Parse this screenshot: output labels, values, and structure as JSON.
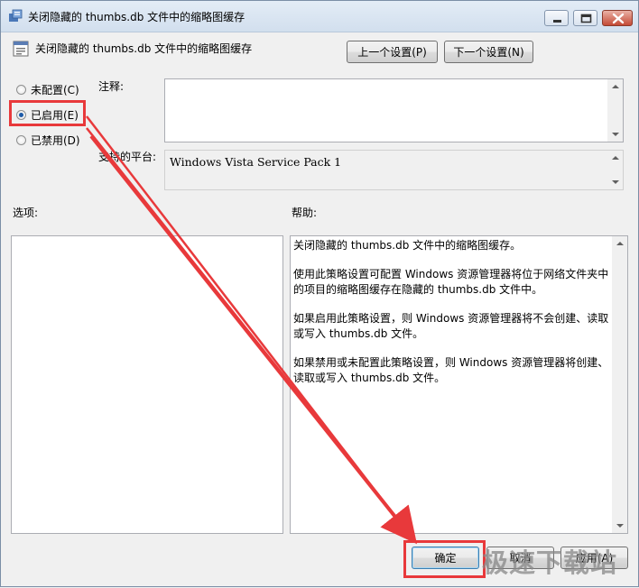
{
  "window": {
    "title": "关闭隐藏的 thumbs.db 文件中的缩略图缓存",
    "controls": [
      "minimize",
      "maximize",
      "close"
    ]
  },
  "policy": {
    "name": "关闭隐藏的 thumbs.db 文件中的缩略图缓存",
    "icon": "policy-setting-icon"
  },
  "nav": {
    "prev_label": "上一个设置(P)",
    "next_label": "下一个设置(N)"
  },
  "state": {
    "options": [
      {
        "label": "未配置(C)",
        "selected": false
      },
      {
        "label": "已启用(E)",
        "selected": true
      },
      {
        "label": "已禁用(D)",
        "selected": false
      }
    ]
  },
  "comment": {
    "label": "注释:",
    "value": ""
  },
  "platform": {
    "label": "支持的平台:",
    "value": "Windows Vista Service Pack 1"
  },
  "options_pane": {
    "label": "选项:"
  },
  "help": {
    "label": "帮助:",
    "paragraphs": [
      "关闭隐藏的 thumbs.db 文件中的缩略图缓存。",
      "使用此策略设置可配置 Windows 资源管理器将位于网络文件夹中的项目的缩略图缓存在隐藏的 thumbs.db 文件中。",
      "如果启用此策略设置，则 Windows 资源管理器将不会创建、读取或写入 thumbs.db 文件。",
      "如果禁用或未配置此策略设置，则 Windows 资源管理器将创建、读取或写入 thumbs.db 文件。"
    ]
  },
  "footer": {
    "ok_label": "确定",
    "cancel_label": "取消",
    "apply_label": "应用(A)"
  },
  "watermark": "极速下载站",
  "annotation_color": "#e8393b"
}
